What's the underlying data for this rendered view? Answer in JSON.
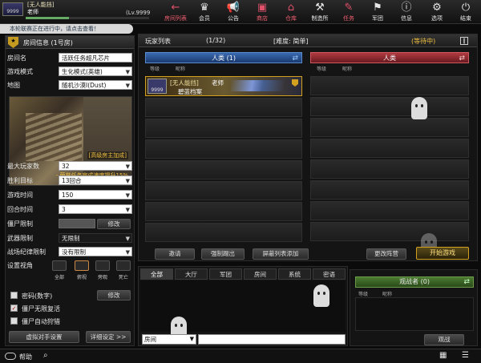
{
  "topbar": {
    "avatar_text": "9999",
    "clan": "[无人能挡]",
    "nickname": "老师",
    "level": "(Lv.9999",
    "nav": [
      {
        "label": "房间列表",
        "icon": "back-arrow-icon",
        "red": true
      },
      {
        "label": "会员",
        "icon": "crown-icon",
        "red": false
      },
      {
        "label": "公告",
        "icon": "megaphone-icon",
        "red": false
      },
      {
        "label": "商店",
        "icon": "shop-icon",
        "red": true
      },
      {
        "label": "仓库",
        "icon": "warehouse-icon",
        "red": true
      },
      {
        "label": "制造所",
        "icon": "factory-icon",
        "red": false
      },
      {
        "label": "任务",
        "icon": "task-icon",
        "red": true
      },
      {
        "label": "军团",
        "icon": "flag-icon",
        "red": false
      },
      {
        "label": "信息",
        "icon": "info-icon",
        "red": false
      },
      {
        "label": "选项",
        "icon": "gear-icon",
        "red": false
      },
      {
        "label": "结束",
        "icon": "power-icon",
        "red": false
      }
    ]
  },
  "notice": "本轮联赛正在进行中，请点击查看！",
  "room": {
    "header": "房间信息 (1号房)",
    "name_label": "房间名",
    "name_value": "活跃任务超凡芯片",
    "mode_label": "游戏模式",
    "mode_value": "生化模式(英雄)",
    "map_label": "地图",
    "map_value": "随机沙漠Ⅰ(Dust)",
    "map_tag": "[高级房主加成]",
    "map_note1": "- 经验值提升15%",
    "map_note2": "- 荣誉任务完成速度提升15%",
    "max_players_label": "最大玩家数",
    "max_players_value": "32",
    "win_target_label": "胜利目标",
    "win_target_value": "13回合",
    "game_time_label": "游戏时间",
    "game_time_value": "150",
    "round_time_label": "回合时间",
    "round_time_value": "3",
    "zombie_limit_label": "僵尸限制",
    "modify_label": "修改",
    "weapon_limit_label": "武器限制",
    "weapon_limit_value": "无限制",
    "discipline_label": "战场纪律限制",
    "discipline_value": "没有限制",
    "view_label": "设置视角",
    "view_options": [
      "全部",
      "俯视",
      "旁观",
      "死亡"
    ],
    "password_label": "密码(数字)",
    "password_modify": "修改",
    "zombie_revive_label": "僵尸无限复活",
    "zombie_auto_label": "僵尸自动狩猎",
    "virtual_btn": "虚拟对手设置",
    "detail_btn": "详细设定 >>"
  },
  "players": {
    "title": "玩家列表",
    "count": "(1/32)",
    "difficulty": "[难度: 简单]",
    "status": "(等待中)",
    "team_left": "人类 (1)",
    "team_right": "人类",
    "col_level": "等级",
    "col_name": "昵称",
    "player": {
      "badge": "9999",
      "clan": "[无人能挡]",
      "name": "老师",
      "card": "碧蓝档案"
    },
    "empty_slots": 7
  },
  "actions": {
    "invite": "邀请",
    "kick": "强制踢出",
    "block": "屏蔽列表添加",
    "change": "更改阵营",
    "start": "开始游戏"
  },
  "chat": {
    "tabs": [
      "全部",
      "大厅",
      "军团",
      "房间",
      "系统",
      "密语"
    ],
    "channel": "房间"
  },
  "observer": {
    "title": "观战者 (0)",
    "col_level": "等级",
    "col_name": "昵称",
    "button": "观战"
  },
  "bottom": {
    "help": "帮助"
  },
  "colors": {
    "blue_team": "#2a5aa0",
    "red_team": "#a02a30",
    "gold": "#d4a020",
    "observer": "#3a6a2a"
  }
}
